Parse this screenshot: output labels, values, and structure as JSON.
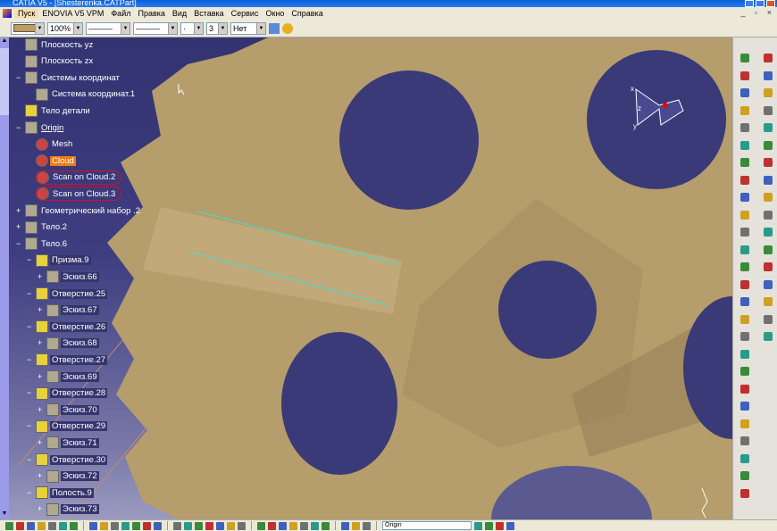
{
  "window": {
    "title": "CATIA V5 - [Shesterenka.CATPart]"
  },
  "menu": [
    "Пуск",
    "ENOVIA V5 VPM",
    "Файл",
    "Правка",
    "Вид",
    "Вставка",
    "Сервис",
    "Окно",
    "Справка"
  ],
  "toolbar": {
    "color_swatch": "#c09a60",
    "transparency": "100%",
    "line_type": "———",
    "line_weight": "———",
    "point_symbol": "·",
    "layer": "3",
    "layer_filter": "Нет"
  },
  "tree": [
    {
      "label": "Плоскость yz",
      "level": 1,
      "icon": "plane-icon"
    },
    {
      "label": "Плоскость zx",
      "level": 1,
      "icon": "plane-icon"
    },
    {
      "label": "Системы координат",
      "level": 1,
      "icon": "axis-system-icon",
      "expand": "-"
    },
    {
      "label": "Система координат.1",
      "level": 2,
      "icon": "axis-icon"
    },
    {
      "label": "Тело детали",
      "level": 1,
      "icon": "gear-body-icon"
    },
    {
      "label": "Origin",
      "level": 1,
      "icon": "origin-icon",
      "expand": "-",
      "style": "u"
    },
    {
      "label": "Mesh",
      "level": 2,
      "icon": "mesh-icon"
    },
    {
      "label": "Cloud",
      "level": 2,
      "icon": "cloud-icon",
      "style": "hl"
    },
    {
      "label": "Scan on Cloud.2",
      "level": 2,
      "icon": "scan-icon",
      "circled": true
    },
    {
      "label": "Scan on Cloud.3",
      "level": 2,
      "icon": "scan-icon",
      "circled": true
    },
    {
      "label": "Геометрический набор .2",
      "level": 1,
      "icon": "geometric-set-icon",
      "expand": "+"
    },
    {
      "label": "Тело.2",
      "level": 1,
      "icon": "body-icon",
      "expand": "+"
    },
    {
      "label": "Тело.6",
      "level": 1,
      "icon": "body-icon",
      "expand": "-"
    },
    {
      "label": "Призма.9",
      "level": 2,
      "icon": "pad-icon",
      "expand": "-",
      "style": "sel"
    },
    {
      "label": "Эскиз.66",
      "level": 3,
      "icon": "sketch-icon",
      "expand": "+",
      "style": "sel"
    },
    {
      "label": "Отверстие.25",
      "level": 2,
      "icon": "hole-icon",
      "expand": "-",
      "style": "sel"
    },
    {
      "label": "Эскиз.67",
      "level": 3,
      "icon": "sketch-icon",
      "expand": "+",
      "style": "sel"
    },
    {
      "label": "Отверстие.26",
      "level": 2,
      "icon": "hole-icon",
      "expand": "-",
      "style": "sel"
    },
    {
      "label": "Эскиз.68",
      "level": 3,
      "icon": "sketch-icon",
      "expand": "+",
      "style": "sel"
    },
    {
      "label": "Отверстие.27",
      "level": 2,
      "icon": "hole-icon",
      "expand": "-",
      "style": "sel"
    },
    {
      "label": "Эскиз.69",
      "level": 3,
      "icon": "sketch-icon",
      "expand": "+",
      "style": "sel"
    },
    {
      "label": "Отверстие.28",
      "level": 2,
      "icon": "hole-icon",
      "expand": "-",
      "style": "sel"
    },
    {
      "label": "Эскиз.70",
      "level": 3,
      "icon": "sketch-icon",
      "expand": "+",
      "style": "sel"
    },
    {
      "label": "Отверстие.29",
      "level": 2,
      "icon": "hole-icon",
      "expand": "-",
      "style": "sel"
    },
    {
      "label": "Эскиз.71",
      "level": 3,
      "icon": "sketch-icon",
      "expand": "+",
      "style": "sel"
    },
    {
      "label": "Отверстие.30",
      "level": 2,
      "icon": "hole-icon",
      "expand": "-",
      "style": "sel"
    },
    {
      "label": "Эскиз.72",
      "level": 3,
      "icon": "sketch-icon",
      "expand": "+",
      "style": "sel"
    },
    {
      "label": "Полость.9",
      "level": 2,
      "icon": "pocket-icon",
      "expand": "-",
      "style": "sel"
    },
    {
      "label": "Эскиз.73",
      "level": 3,
      "icon": "sketch-icon",
      "expand": "+",
      "style": "sel"
    }
  ],
  "compass": {
    "x": "x",
    "y": "y",
    "z": "z"
  },
  "bottom": {
    "current_element": "Origin"
  },
  "colors": {
    "gear": "#b59d6c",
    "hole": "#3a3a78",
    "accent": "#d0102a"
  }
}
